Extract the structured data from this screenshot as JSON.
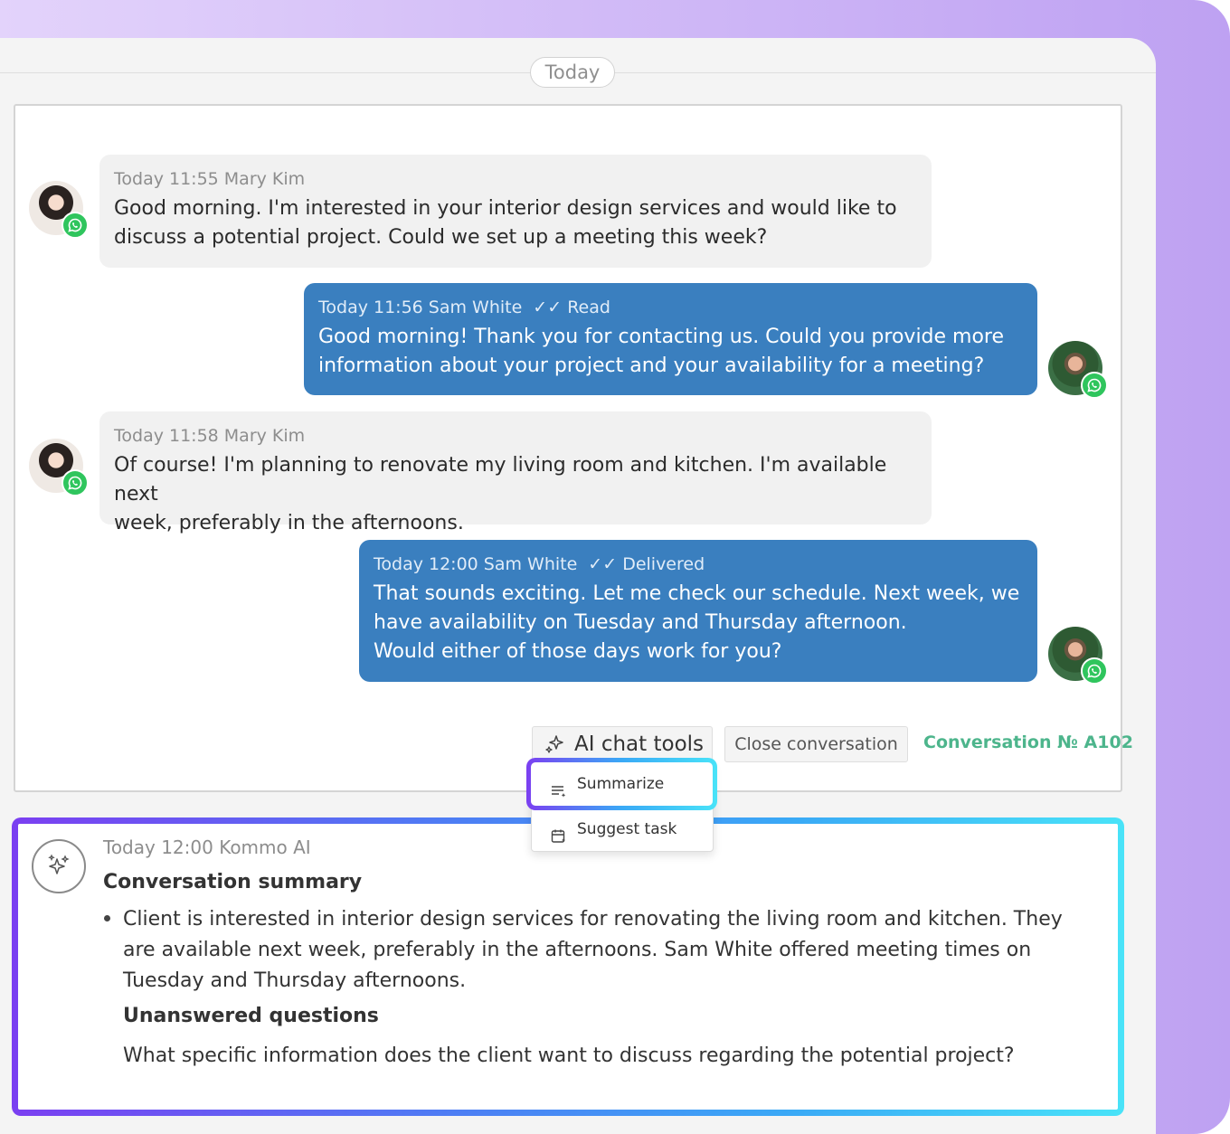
{
  "date_separator": "Today",
  "messages": [
    {
      "meta": "Today 11:55 Mary Kim",
      "status": "",
      "text": "Good morning. I'm interested in your interior design services and would like to\ndiscuss a potential project. Could we set up a meeting this week?"
    },
    {
      "meta": "Today 11:56 Sam White",
      "status": "Read",
      "text": "Good morning! Thank you for contacting us. Could you provide more\ninformation about your project and your availability for a meeting?"
    },
    {
      "meta": "Today 11:58 Mary Kim",
      "status": "",
      "text": "Of course! I'm planning to renovate my living room and kitchen. I'm available next\nweek, preferably in the afternoons."
    },
    {
      "meta": "Today 12:00 Sam White",
      "status": "Delivered",
      "text": "That sounds exciting. Let me check our schedule. Next week, we\nhave availability on Tuesday and Thursday afternoon.\nWould either of those days work for you?"
    }
  ],
  "toolbar": {
    "ai_tools_label": "AI chat tools",
    "close_label": "Close conversation",
    "conversation_number": "Conversation № A102"
  },
  "ai_menu": {
    "items": [
      {
        "label": "Summarize",
        "icon": "summarize-icon"
      },
      {
        "label": "Suggest task",
        "icon": "calendar-task-icon"
      }
    ]
  },
  "summary": {
    "meta": "Today 12:00 Kommo AI",
    "title": "Conversation summary",
    "text": "Client is interested in interior design services for renovating the living room and kitchen. They are available next week, preferably in the afternoons. Sam White offered meeting times on Tuesday and Thursday afternoons.",
    "subheading": "Unanswered questions",
    "question": "What specific information does the client want to discuss regarding the potential project?"
  },
  "colors": {
    "outgoing_bubble": "#3a7fbf",
    "incoming_bubble": "#f1f1f1",
    "whatsapp": "#2fc55d",
    "conversation_number": "#4db58c"
  }
}
